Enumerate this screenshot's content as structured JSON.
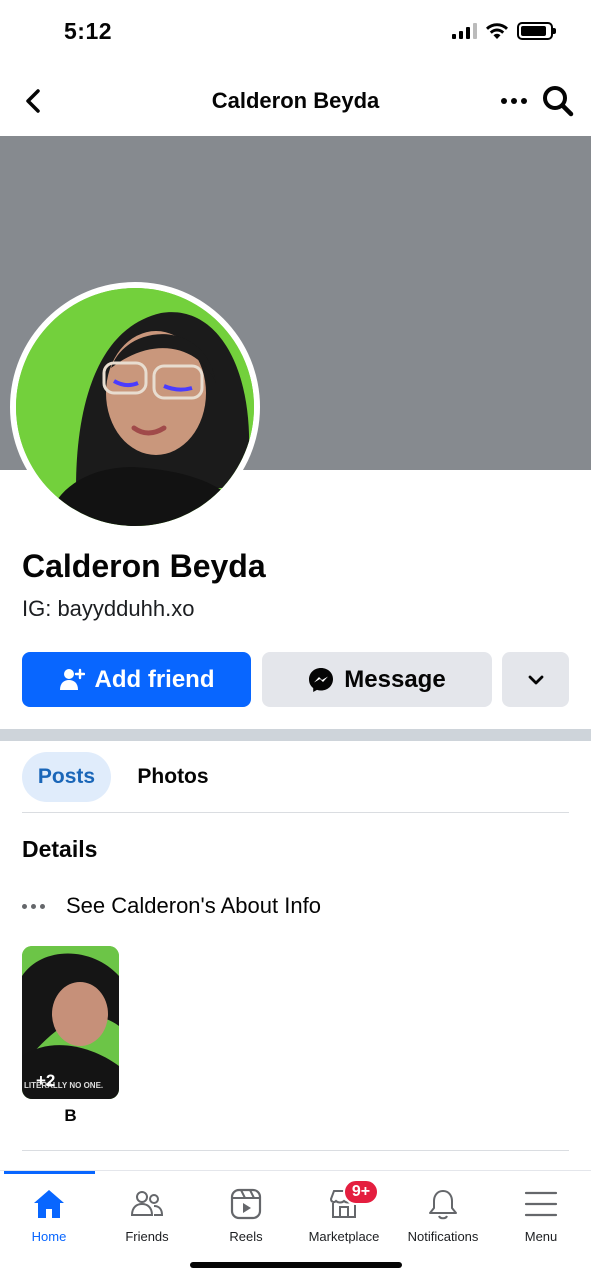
{
  "status_bar": {
    "time": "5:12",
    "battery_level": 0.9
  },
  "header": {
    "title": "Calderon Beyda"
  },
  "profile": {
    "name": "Calderon Beyda",
    "bio": "IG: bayydduhh.xo"
  },
  "actions": {
    "add_friend": "Add friend",
    "message": "Message"
  },
  "tabs": [
    {
      "label": "Posts",
      "active": true
    },
    {
      "label": "Photos",
      "active": false
    }
  ],
  "details": {
    "heading": "Details",
    "about_link": "See Calderon's About Info"
  },
  "featured": {
    "count": "+2",
    "watermark": "LITERALLY NO ONE.",
    "label": "B"
  },
  "bottom_nav": {
    "items": [
      {
        "label": "Home",
        "icon": "home-icon",
        "active": true
      },
      {
        "label": "Friends",
        "icon": "friends-icon"
      },
      {
        "label": "Reels",
        "icon": "reels-icon"
      },
      {
        "label": "Marketplace",
        "icon": "marketplace-icon",
        "badge": "9+"
      },
      {
        "label": "Notifications",
        "icon": "bell-icon"
      },
      {
        "label": "Menu",
        "icon": "menu-icon"
      }
    ]
  },
  "colors": {
    "accent": "#0866ff",
    "cover": "#868a8f",
    "badge": "#e41e3f",
    "avatar_bg": "#73d03c"
  }
}
